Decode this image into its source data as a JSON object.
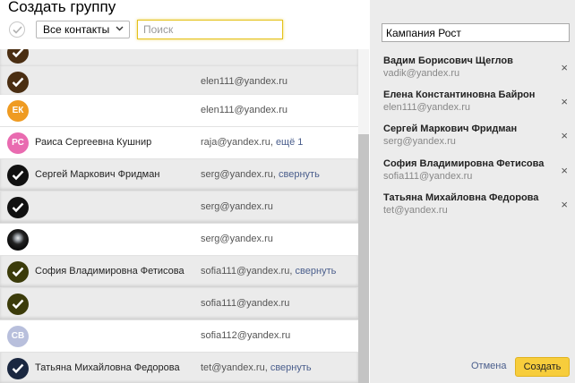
{
  "header": {
    "title": "Создать группу",
    "filter_value": "Все контакты",
    "search_placeholder": "Поиск"
  },
  "contacts": [
    {
      "selected": true,
      "avatar": "check",
      "color": "#4a2e12",
      "initials": "",
      "name": "",
      "email": "",
      "link": ""
    },
    {
      "selected": true,
      "avatar": "check",
      "color": "#4a2e12",
      "initials": "",
      "name": "",
      "email": "elen111@yandex.ru",
      "link": ""
    },
    {
      "selected": false,
      "avatar": "initials",
      "color": "#ef9b22",
      "initials": "ЕК",
      "name": "",
      "email": "elen111@yandex.ru",
      "link": ""
    },
    {
      "selected": false,
      "avatar": "initials",
      "color": "#e96bb0",
      "initials": "РС",
      "name": "Раиса Сергеевна Кушнир",
      "email": "raja@yandex.ru, ",
      "link": "ещё 1"
    },
    {
      "selected": true,
      "avatar": "check",
      "color": "#111111",
      "initials": "",
      "name": "Сергей Маркович Фридман",
      "email": "serg@yandex.ru, ",
      "link": "свернуть"
    },
    {
      "selected": true,
      "avatar": "check",
      "color": "#111111",
      "initials": "",
      "name": "",
      "email": "serg@yandex.ru",
      "link": ""
    },
    {
      "selected": false,
      "avatar": "photo",
      "color": "#111111",
      "initials": "",
      "name": "",
      "email": "serg@yandex.ru",
      "link": ""
    },
    {
      "selected": true,
      "avatar": "check",
      "color": "#3b3b0a",
      "initials": "",
      "name": "София Владимировна Фетисова",
      "email": "sofia111@yandex.ru, ",
      "link": "свернуть"
    },
    {
      "selected": true,
      "avatar": "check",
      "color": "#3b3b0a",
      "initials": "",
      "name": "",
      "email": "sofia111@yandex.ru",
      "link": ""
    },
    {
      "selected": false,
      "avatar": "initials",
      "color": "#b8bfdc",
      "initials": "СВ",
      "name": "",
      "email": "sofia112@yandex.ru",
      "link": ""
    },
    {
      "selected": true,
      "avatar": "check",
      "color": "#1a2740",
      "initials": "",
      "name": "Татьяна Михайловна Федорова",
      "email": "tet@yandex.ru, ",
      "link": "свернуть"
    }
  ],
  "group": {
    "name": "Кампания Рост",
    "members": [
      {
        "name": "Вадим Борисович Щеглов",
        "email": "vadik@yandex.ru"
      },
      {
        "name": "Елена Константиновна Байрон",
        "email": "elen111@yandex.ru"
      },
      {
        "name": "Сергей Маркович Фридман",
        "email": "serg@yandex.ru"
      },
      {
        "name": "София Владимировна Фетисова",
        "email": "sofia111@yandex.ru"
      },
      {
        "name": "Татьяна Михайловна Федорова",
        "email": "tet@yandex.ru"
      }
    ],
    "remove_glyph": "×"
  },
  "actions": {
    "cancel_label": "Отмена",
    "create_label": "Создать"
  },
  "colors": {
    "accent": "#f7cd3c",
    "link": "#4a5e8c",
    "selected_row": "#ebebeb"
  }
}
